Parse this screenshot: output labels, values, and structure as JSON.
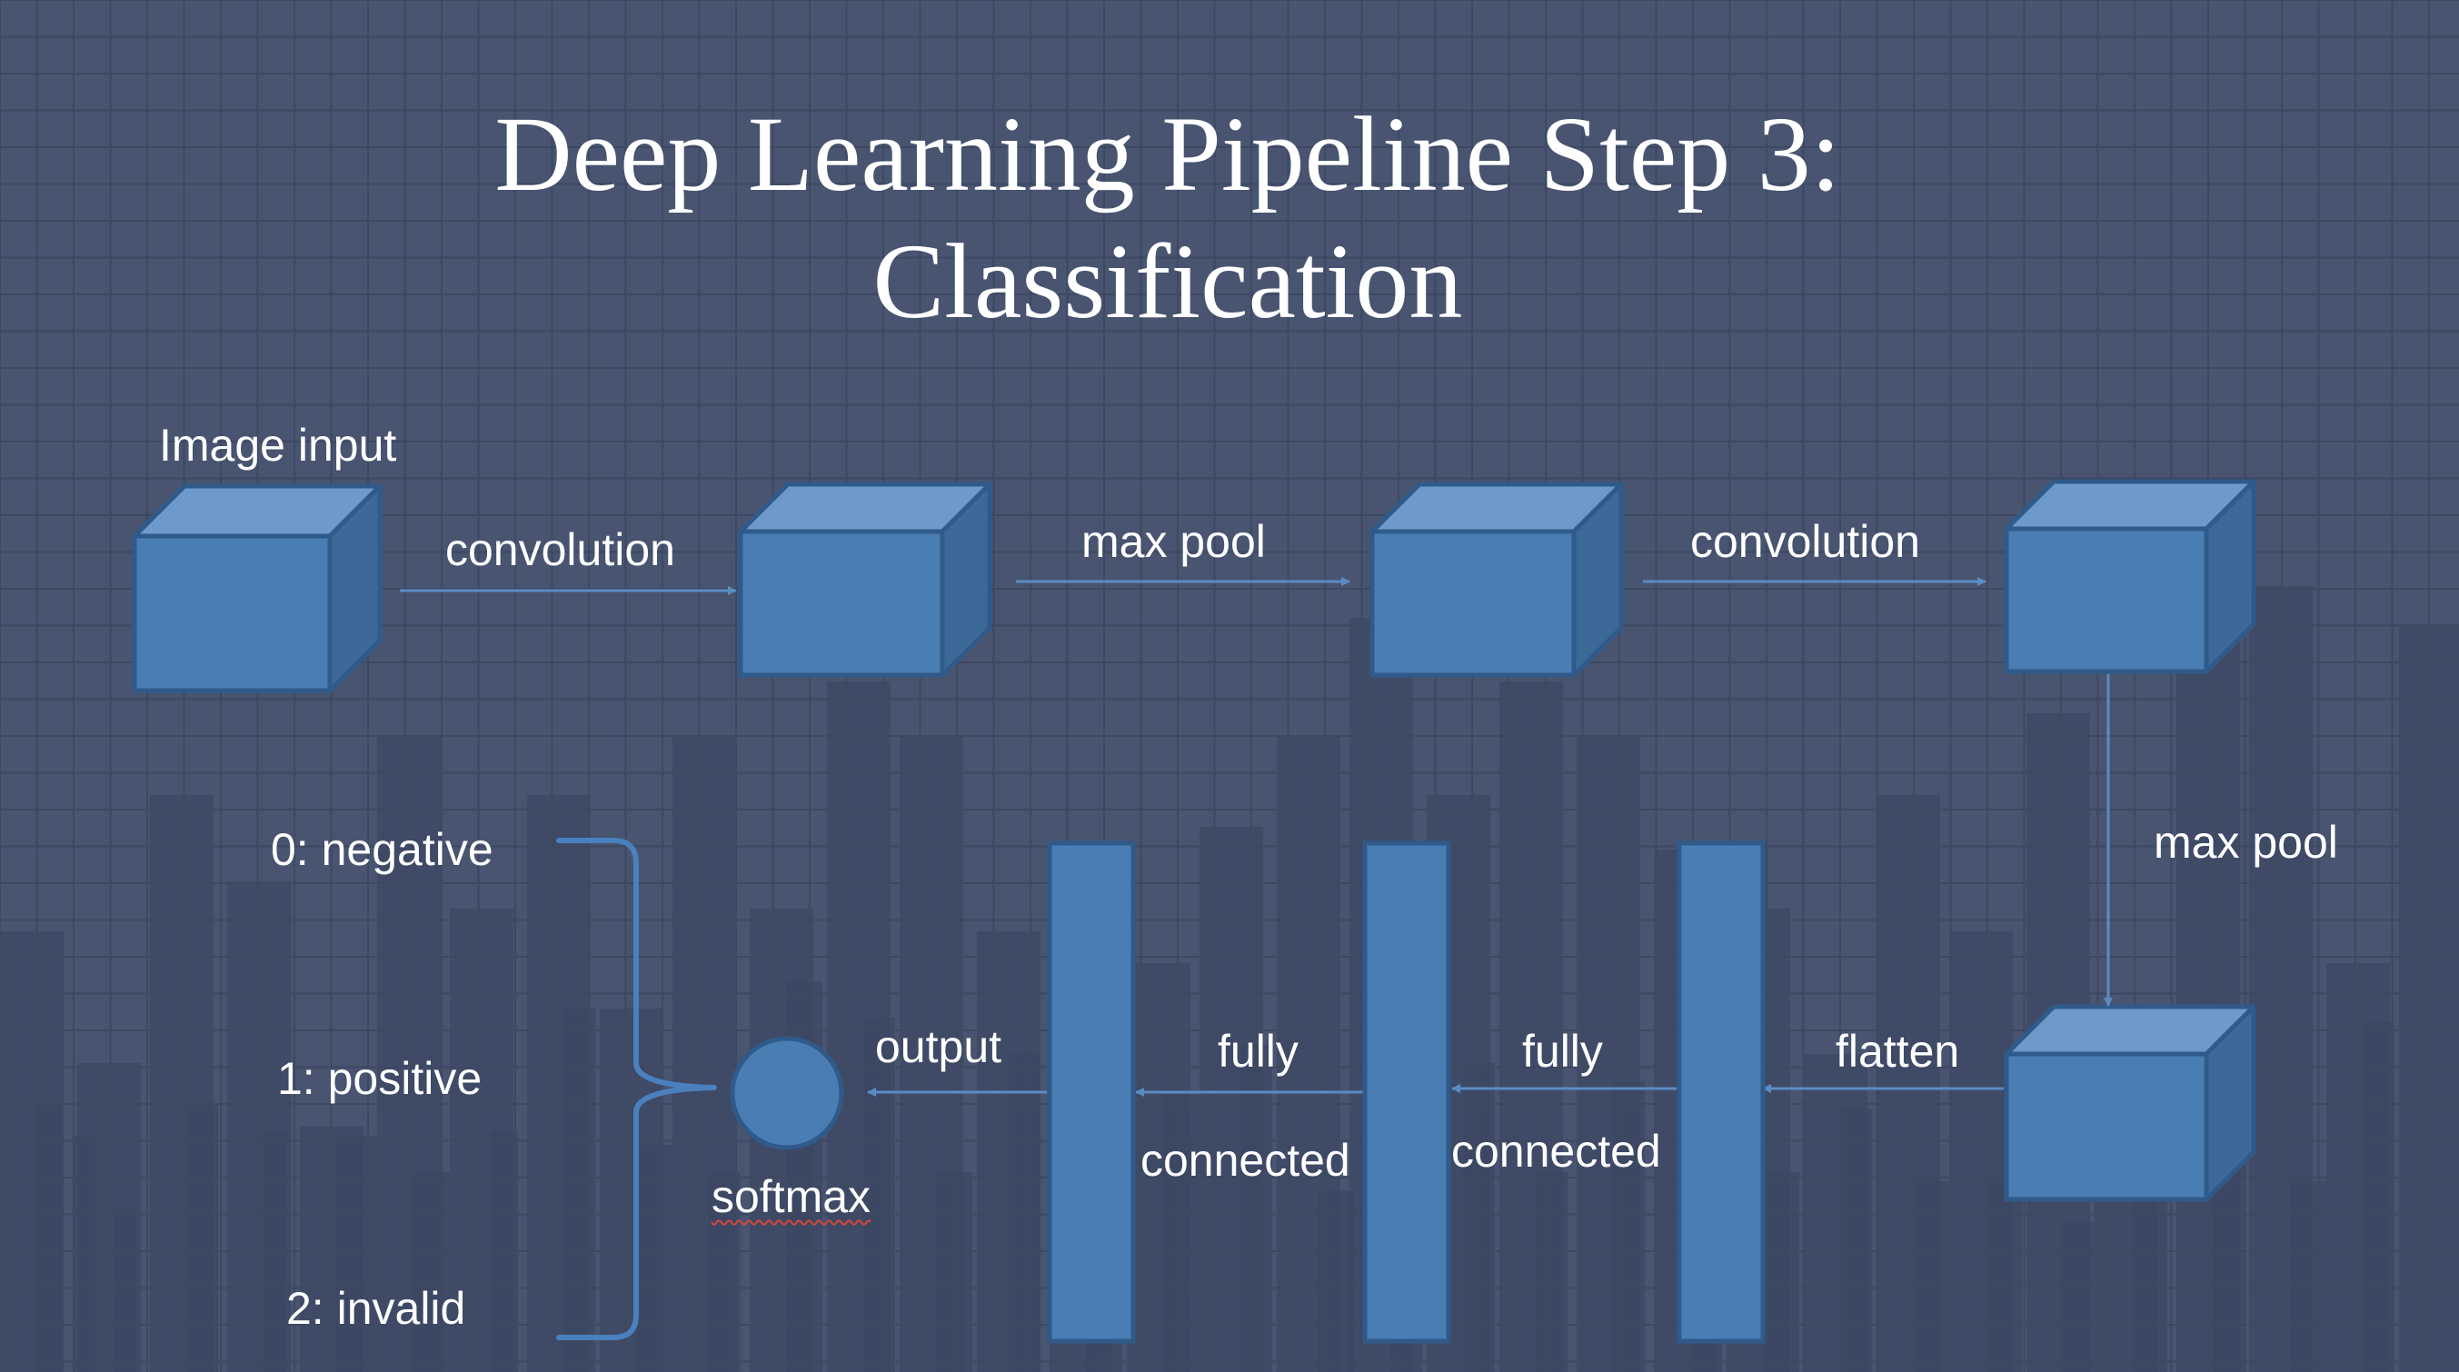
{
  "slide": {
    "title_line1": "Deep Learning Pipeline Step 3:",
    "title_line2": "Classification"
  },
  "diagram": {
    "image_input_label": "Image input",
    "edge_convolution_1": "convolution",
    "edge_max_pool_1": "max pool",
    "edge_convolution_2": "convolution",
    "edge_max_pool_2": "max pool",
    "edge_flatten": "flatten",
    "edge_fully_1": "fully",
    "edge_connected_1": "connected",
    "edge_fully_2": "fully",
    "edge_connected_2": "connected",
    "edge_output": "output",
    "softmax_label": "softmax",
    "classes": [
      "0: negative",
      "1: positive",
      "2: invalid"
    ]
  },
  "colors": {
    "background": "#485470",
    "grid_line": "#3d4862",
    "bar_fill": "#3c4763",
    "cube_front": "#4a7db3",
    "cube_top": "#6d9acb",
    "cube_side": "#3d6998",
    "cube_stroke": "#2f5a8a",
    "arrow": "#5a8cc4",
    "brace": "#4a80bd",
    "text": "#ffffff"
  }
}
